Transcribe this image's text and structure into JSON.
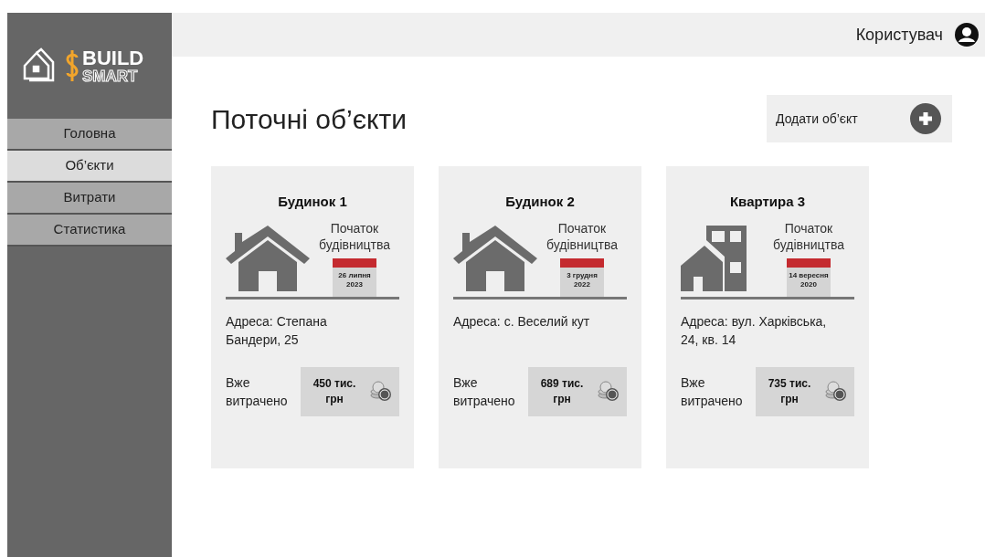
{
  "logo": {
    "line_1": "BUILD",
    "line_2": "SMART"
  },
  "sidebar": {
    "items": [
      {
        "label": "Головна",
        "selected": false
      },
      {
        "label": "Об’єкти",
        "selected": true
      },
      {
        "label": "Витрати",
        "selected": false
      },
      {
        "label": "Статистика",
        "selected": false
      }
    ]
  },
  "header": {
    "user": "Користувач"
  },
  "page_title": "Поточні об’єкти",
  "add_button": "Додати об’єкт",
  "cards": [
    {
      "kind": "house",
      "title": "Будинок 1",
      "start_label": "Початок будівництва",
      "date": "26 липня",
      "year": "2023",
      "address": "Адреса: Степана Бандери, 25",
      "spent_label": "Вже витрачено",
      "spent": "450 тис. грн"
    },
    {
      "kind": "house",
      "title": "Будинок 2",
      "start_label": "Початок будівництва",
      "date": "3 грудня",
      "year": "2022",
      "address": "Адреса: с. Веселий кут",
      "spent_label": "Вже витрачено",
      "spent": "689 тис. грн"
    },
    {
      "kind": "apartment",
      "title": "Квартира 3",
      "start_label": "Початок будівництва",
      "date": "14 вересня",
      "year": "2020",
      "address": "Адреса: вул. Харківська, 24, кв. 14",
      "spent_label": "Вже витрачено",
      "spent": "735 тис. грн"
    }
  ]
}
